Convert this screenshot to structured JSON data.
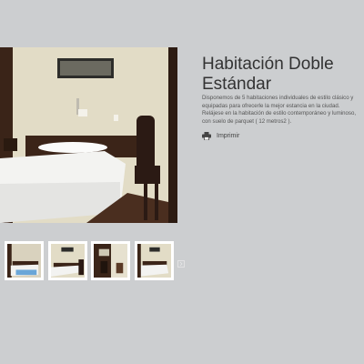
{
  "room": {
    "title": "Habitación Doble Estándar",
    "description": "Disponemos de 5 habitaciones individuales de estilo clásico y equipadas para ofrecerle la mejor estancia en la ciudad. Relájese en la habitación de estilo contemporáneo y luminoso, con suelo de parquet ( 12 metros2 ).",
    "print_label": "Imprimir"
  },
  "icons": {
    "print": "printer-icon",
    "next": "next-arrow-icon"
  },
  "colors": {
    "background": "#ccced0",
    "title": "#333333",
    "text": "#555555"
  }
}
